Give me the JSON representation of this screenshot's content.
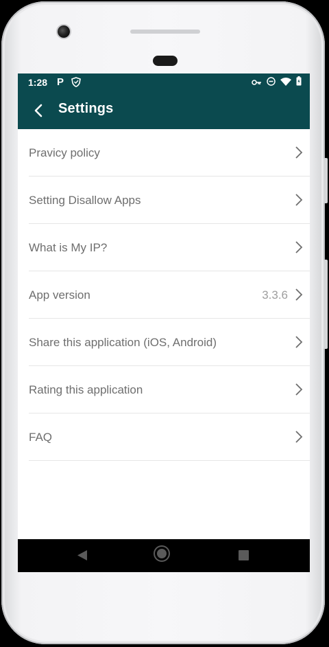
{
  "status_bar": {
    "time": "1:28",
    "left_icons": [
      "p-icon",
      "shield-icon"
    ],
    "right_icons": [
      "vpn-key-icon",
      "do-not-disturb-icon",
      "wifi-icon",
      "battery-icon"
    ],
    "p_glyph": "P"
  },
  "app_bar": {
    "title": "Settings",
    "background_color": "#0b4a4f"
  },
  "settings": {
    "items": [
      {
        "label": "Pravicy policy",
        "value": ""
      },
      {
        "label": "Setting Disallow Apps",
        "value": ""
      },
      {
        "label": "What is My IP?",
        "value": ""
      },
      {
        "label": "App version",
        "value": "3.3.6"
      },
      {
        "label": "Share this application (iOS, Android)",
        "value": ""
      },
      {
        "label": "Rating this application",
        "value": ""
      },
      {
        "label": "FAQ",
        "value": ""
      }
    ]
  },
  "nav_bar": {
    "buttons": [
      "back-triangle-icon",
      "home-circle-icon",
      "recents-square-icon"
    ]
  }
}
